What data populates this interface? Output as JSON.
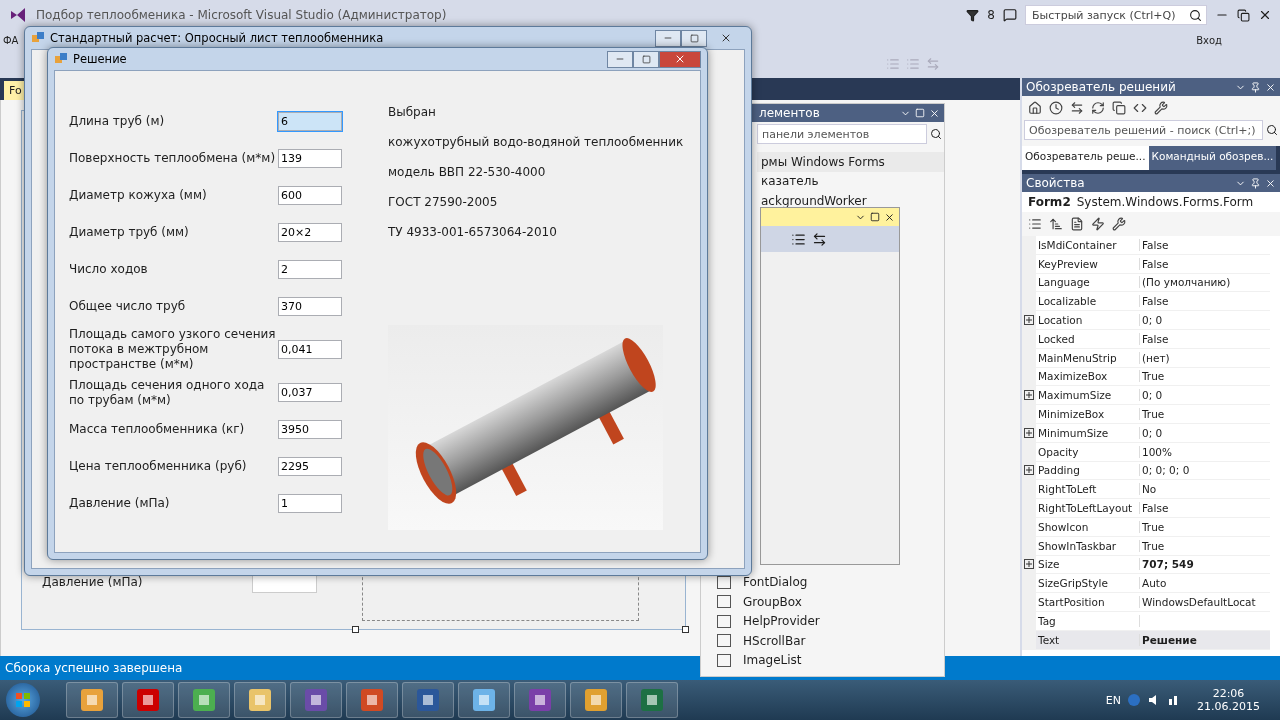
{
  "vs": {
    "title": "Подбор теплообменика - Microsoft Visual Studio (Администратор)",
    "notifications": "8",
    "quick_launch": {
      "placeholder": "Быстрый запуск (Ctrl+Q)"
    },
    "sign_in": "Вход",
    "menu_fragment": "ФА",
    "doc_tab": "Fo"
  },
  "designer": {
    "label": "Давление (мПа)"
  },
  "toolbox": {
    "title": "лементов",
    "search": {
      "placeholder": "панели элементов"
    },
    "top_items": [
      {
        "label": "рмы Windows Forms",
        "kind": "group"
      },
      {
        "label": "казатель",
        "kind": "item"
      },
      {
        "label": "ackgroundWorker",
        "kind": "item"
      }
    ],
    "bottom_items": [
      {
        "label": "FontDialog",
        "kind": "item"
      },
      {
        "label": "GroupBox",
        "kind": "item"
      },
      {
        "label": "HelpProvider",
        "kind": "item"
      },
      {
        "label": "HScrollBar",
        "kind": "item"
      },
      {
        "label": "ImageList",
        "kind": "item"
      }
    ]
  },
  "solution_explorer": {
    "title": "Обозреватель решений",
    "search": {
      "placeholder": "Обозреватель решений - поиск (Ctrl+;)"
    },
    "tabs": [
      {
        "label": "Обозреватель реше...",
        "selected": true
      },
      {
        "label": "Командный обозрев...",
        "selected": false
      }
    ]
  },
  "properties": {
    "title": "Свойства",
    "object": "Form2",
    "type": "System.Windows.Forms.Form",
    "rows": [
      {
        "name": "IsMdiContainer",
        "value": "False",
        "expandable": false,
        "modified": false,
        "selected": false
      },
      {
        "name": "KeyPreview",
        "value": "False",
        "expandable": false,
        "modified": false,
        "selected": false
      },
      {
        "name": "Language",
        "value": "(По умолчанию)",
        "expandable": false,
        "modified": false,
        "selected": false
      },
      {
        "name": "Localizable",
        "value": "False",
        "expandable": false,
        "modified": false,
        "selected": false
      },
      {
        "name": "Location",
        "value": "0; 0",
        "expandable": true,
        "modified": false,
        "selected": false
      },
      {
        "name": "Locked",
        "value": "False",
        "expandable": false,
        "modified": false,
        "selected": false
      },
      {
        "name": "MainMenuStrip",
        "value": "(нет)",
        "expandable": false,
        "modified": false,
        "selected": false
      },
      {
        "name": "MaximizeBox",
        "value": "True",
        "expandable": false,
        "modified": false,
        "selected": false
      },
      {
        "name": "MaximumSize",
        "value": "0; 0",
        "expandable": true,
        "modified": false,
        "selected": false
      },
      {
        "name": "MinimizeBox",
        "value": "True",
        "expandable": false,
        "modified": false,
        "selected": false
      },
      {
        "name": "MinimumSize",
        "value": "0; 0",
        "expandable": true,
        "modified": false,
        "selected": false
      },
      {
        "name": "Opacity",
        "value": "100%",
        "expandable": false,
        "modified": false,
        "selected": false
      },
      {
        "name": "Padding",
        "value": "0; 0; 0; 0",
        "expandable": true,
        "modified": false,
        "selected": false
      },
      {
        "name": "RightToLeft",
        "value": "No",
        "expandable": false,
        "modified": false,
        "selected": false
      },
      {
        "name": "RightToLeftLayout",
        "value": "False",
        "expandable": false,
        "modified": false,
        "selected": false
      },
      {
        "name": "ShowIcon",
        "value": "True",
        "expandable": false,
        "modified": false,
        "selected": false
      },
      {
        "name": "ShowInTaskbar",
        "value": "True",
        "expandable": false,
        "modified": false,
        "selected": false
      },
      {
        "name": "Size",
        "value": "707; 549",
        "expandable": true,
        "modified": true,
        "selected": false
      },
      {
        "name": "SizeGripStyle",
        "value": "Auto",
        "expandable": false,
        "modified": false,
        "selected": false
      },
      {
        "name": "StartPosition",
        "value": "WindowsDefaultLocat",
        "expandable": false,
        "modified": false,
        "selected": false
      },
      {
        "name": "Tag",
        "expandable": false,
        "selected": false
      },
      {
        "name": "Text",
        "value": "Решение",
        "expandable": false,
        "modified": true,
        "selected": true
      }
    ]
  },
  "status_bar": "Сборка успешно завершена",
  "taskbar": {
    "language": "EN",
    "time": "22:06",
    "date": "21.06.2015"
  },
  "survey_window": {
    "title": "Стандартный расчет: Опросный лист теплообменника"
  },
  "result_window": {
    "title": "Решение",
    "fields": [
      {
        "label": "Длина труб (м)",
        "value": "6",
        "selected": true
      },
      {
        "label": "Поверхность теплообмена (м*м)",
        "value": "139",
        "selected": false
      },
      {
        "label": "Диаметр кожуха (мм)",
        "value": "600",
        "selected": false
      },
      {
        "label": "Диаметр труб (мм)",
        "value": "20×2",
        "selected": false
      },
      {
        "label": "Число ходов",
        "value": "2",
        "selected": false
      },
      {
        "label": "Общее число труб",
        "value": "370",
        "selected": false
      },
      {
        "label": "Площадь самого узкого сечения потока в межтрубном пространстве (м*м)",
        "value": "0,041",
        "selected": false
      },
      {
        "label": "Площадь сечения одного хода по трубам (м*м)",
        "value": "0,037",
        "selected": false
      },
      {
        "label": "Масса теплообменника (кг)",
        "value": "3950",
        "selected": false
      },
      {
        "label": "Цена теплообменника (руб)",
        "value": "2295",
        "selected": false
      },
      {
        "label": "Давление (мПа)",
        "value": "1",
        "selected": false
      }
    ],
    "result_lines": [
      "Выбран",
      "кожухотрубный водо-водяной теплообменник",
      "модель ВВП 22-530-4000",
      "ГОСТ 27590-2005",
      "ТУ 4933-001-6573064-2010"
    ]
  }
}
